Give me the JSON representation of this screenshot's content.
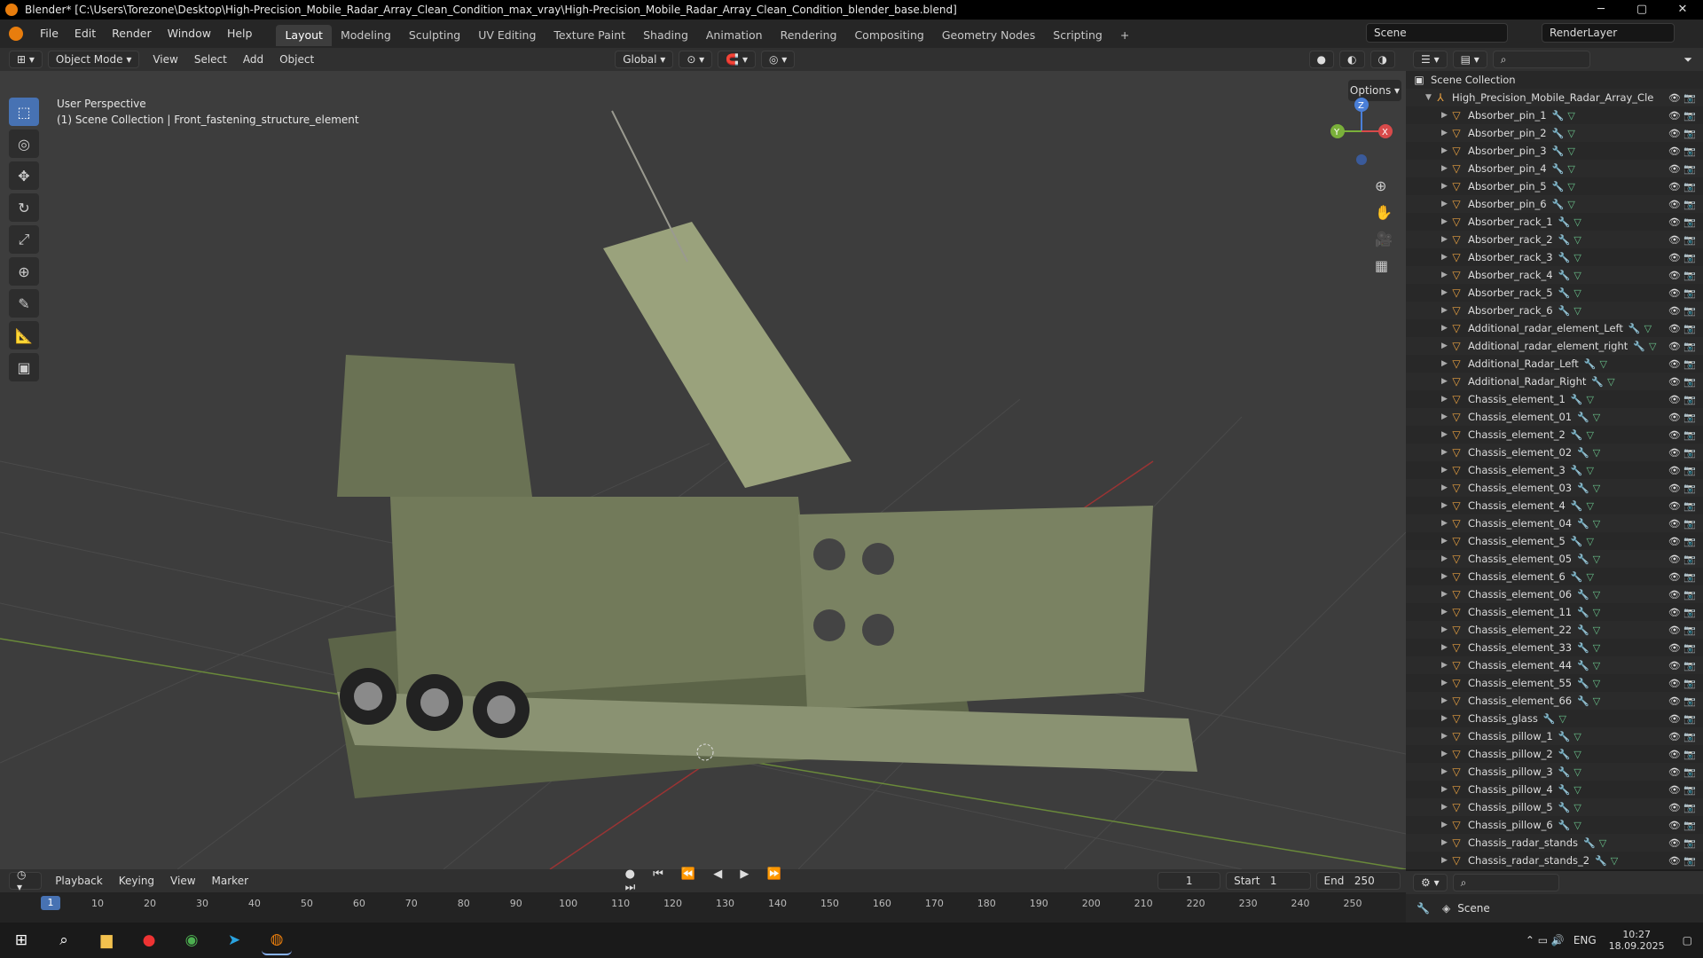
{
  "window": {
    "title": "Blender* [C:\\Users\\Torezone\\Desktop\\High-Precision_Mobile_Radar_Array_Clean_Condition_max_vray\\High-Precision_Mobile_Radar_Array_Clean_Condition_blender_base.blend]",
    "min": "─",
    "max": "▢",
    "close": "✕"
  },
  "menu": [
    "File",
    "Edit",
    "Render",
    "Window",
    "Help"
  ],
  "workspaces": [
    "Layout",
    "Modeling",
    "Sculpting",
    "UV Editing",
    "Texture Paint",
    "Shading",
    "Animation",
    "Rendering",
    "Compositing",
    "Geometry Nodes",
    "Scripting",
    "+"
  ],
  "scene": "Scene",
  "render_layer": "RenderLayer",
  "header": {
    "mode": "Object Mode",
    "items": [
      "View",
      "Select",
      "Add",
      "Object"
    ],
    "orientation": "Global",
    "options": "Options"
  },
  "viewport": {
    "perspective": "User Perspective",
    "collection": "(1) Scene Collection | Front_fastening_structure_element"
  },
  "gizmo": {
    "x": "X",
    "y": "Y",
    "z": "Z"
  },
  "outliner": {
    "title": "Scene Collection",
    "root": "High_Precision_Mobile_Radar_Array_Cle",
    "items": [
      "Absorber_pin_1",
      "Absorber_pin_2",
      "Absorber_pin_3",
      "Absorber_pin_4",
      "Absorber_pin_5",
      "Absorber_pin_6",
      "Absorber_rack_1",
      "Absorber_rack_2",
      "Absorber_rack_3",
      "Absorber_rack_4",
      "Absorber_rack_5",
      "Absorber_rack_6",
      "Additional_radar_element_Left",
      "Additional_radar_element_right",
      "Additional_Radar_Left",
      "Additional_Radar_Right",
      "Chassis_element_1",
      "Chassis_element_01",
      "Chassis_element_2",
      "Chassis_element_02",
      "Chassis_element_3",
      "Chassis_element_03",
      "Chassis_element_4",
      "Chassis_element_04",
      "Chassis_element_5",
      "Chassis_element_05",
      "Chassis_element_6",
      "Chassis_element_06",
      "Chassis_element_11",
      "Chassis_element_22",
      "Chassis_element_33",
      "Chassis_element_44",
      "Chassis_element_55",
      "Chassis_element_66",
      "Chassis_glass",
      "Chassis_pillow_1",
      "Chassis_pillow_2",
      "Chassis_pillow_3",
      "Chassis_pillow_4",
      "Chassis_pillow_5",
      "Chassis_pillow_6",
      "Chassis_radar_stands",
      "Chassis_radar_stands_2"
    ]
  },
  "timeline": {
    "menus": [
      "Playback",
      "Keying",
      "View",
      "Marker"
    ],
    "current_frame": "1",
    "start_label": "Start",
    "start": "1",
    "end_label": "End",
    "end": "250",
    "ticks": [
      "1",
      "10",
      "20",
      "30",
      "40",
      "50",
      "60",
      "70",
      "80",
      "90",
      "100",
      "110",
      "120",
      "130",
      "140",
      "150",
      "160",
      "170",
      "180",
      "190",
      "200",
      "210",
      "220",
      "230",
      "240",
      "250"
    ]
  },
  "properties": {
    "scene": "Scene"
  },
  "taskbar": {
    "lang": "ENG",
    "time": "10:27",
    "date": "18.09.2025"
  }
}
